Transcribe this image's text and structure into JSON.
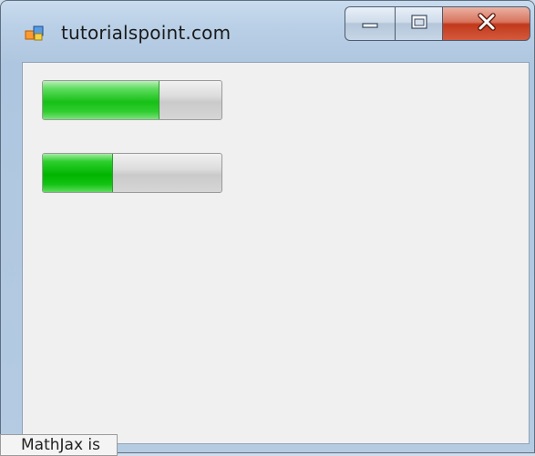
{
  "window": {
    "title": "tutorialspoint.com",
    "app_icon": "windows-form-icon",
    "buttons": {
      "minimize_icon": "minimize-icon",
      "maximize_icon": "maximize-icon",
      "close_icon": "close-icon"
    }
  },
  "progress_bars": [
    {
      "value_percent": 65,
      "color": "#17c017"
    },
    {
      "value_percent": 39,
      "color": "#00b400"
    }
  ],
  "status_message": "MathJax is"
}
